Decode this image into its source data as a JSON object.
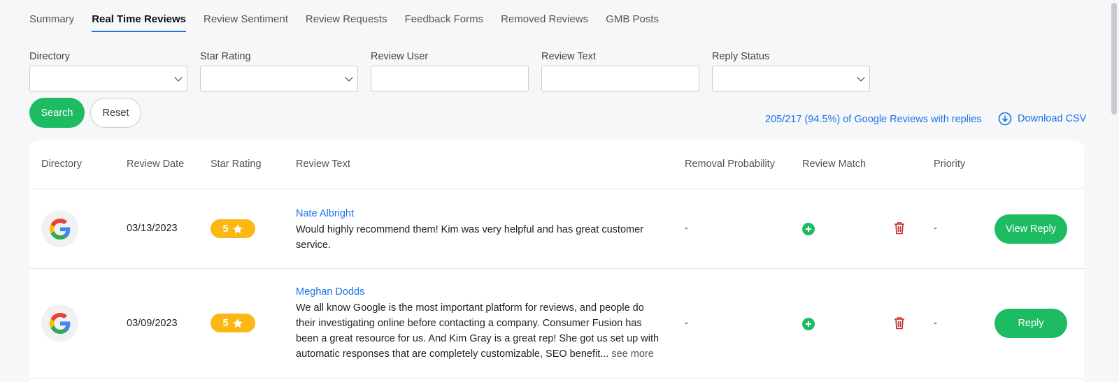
{
  "tabs": [
    {
      "label": "Summary",
      "active": false
    },
    {
      "label": "Real Time Reviews",
      "active": true
    },
    {
      "label": "Review Sentiment",
      "active": false
    },
    {
      "label": "Review Requests",
      "active": false
    },
    {
      "label": "Feedback Forms",
      "active": false
    },
    {
      "label": "Removed Reviews",
      "active": false
    },
    {
      "label": "GMB Posts",
      "active": false
    }
  ],
  "filters": {
    "directory": {
      "label": "Directory",
      "value": ""
    },
    "star_rating": {
      "label": "Star Rating",
      "value": ""
    },
    "review_user": {
      "label": "Review User",
      "value": ""
    },
    "review_text": {
      "label": "Review Text",
      "value": ""
    },
    "reply_status": {
      "label": "Reply Status",
      "value": ""
    }
  },
  "actions": {
    "search_label": "Search",
    "reset_label": "Reset",
    "summary_text": "205/217 (94.5%) of Google Reviews with replies",
    "download_label": "Download CSV"
  },
  "table": {
    "headers": [
      "Directory",
      "Review Date",
      "Star Rating",
      "Review Text",
      "Removal Probability",
      "Review Match",
      "Priority"
    ],
    "rows": [
      {
        "directory": "google-icon",
        "date": "03/13/2023",
        "rating": "5",
        "reviewer": "Nate Albright",
        "text": "Would highly recommend them! Kim was very helpful and has great customer service.",
        "see_more": "",
        "removal_probability": "-",
        "priority": "-",
        "action": "View Reply"
      },
      {
        "directory": "google-icon",
        "date": "03/09/2023",
        "rating": "5",
        "reviewer": "Meghan Dodds",
        "text": "We all know Google is the most important platform for reviews, and people do their investigating online before contacting a company. Consumer Fusion has been a great resource for us. And Kim Gray is a great rep! She got us set up with automatic responses that are completely customizable, SEO benefit...",
        "see_more": "see more",
        "removal_probability": "-",
        "priority": "-",
        "action": "Reply"
      }
    ]
  },
  "colors": {
    "accent_green": "#1dbc63",
    "link_blue": "#1a73e8",
    "star_badge": "#fbb813",
    "delete_red": "#c62828"
  }
}
